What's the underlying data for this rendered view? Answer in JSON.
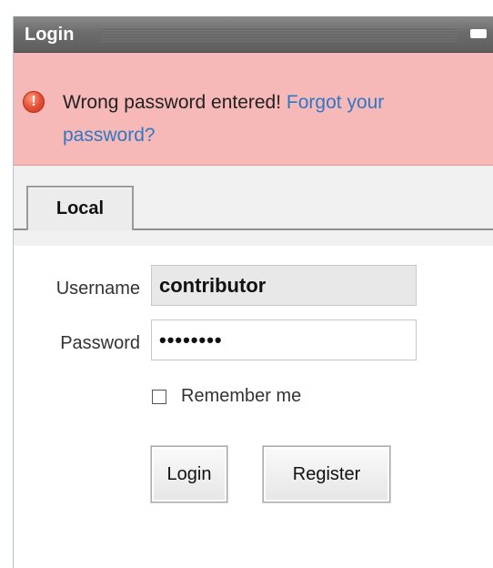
{
  "window": {
    "title": "Login"
  },
  "alert": {
    "message": "Wrong password entered!",
    "link_line1": "Forgot your",
    "link_line2": "password?",
    "icon": "warning-icon"
  },
  "tabs": [
    {
      "label": "Local"
    }
  ],
  "form": {
    "username_label": "Username",
    "username_value": "contributor",
    "password_label": "Password",
    "password_value": "••••••••",
    "remember_label": "Remember me",
    "remember_checked": false
  },
  "buttons": {
    "login": "Login",
    "register": "Register"
  }
}
